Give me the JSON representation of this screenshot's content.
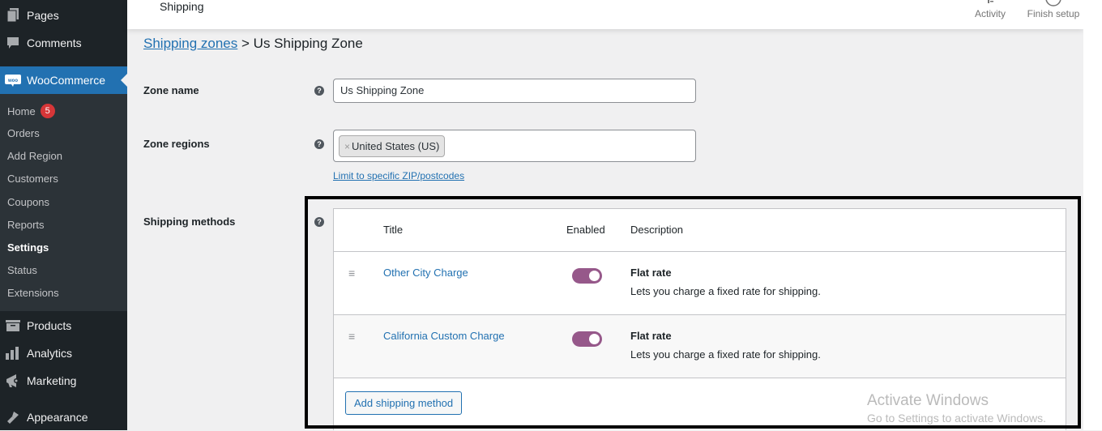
{
  "sidebar": {
    "top_items": [
      {
        "label": "Pages",
        "icon": "pages-icon"
      },
      {
        "label": "Comments",
        "icon": "comments-icon"
      }
    ],
    "active_menu": {
      "label": "WooCommerce",
      "icon": "woocommerce-icon"
    },
    "submenu": [
      {
        "label": "Home",
        "badge": "5"
      },
      {
        "label": "Orders"
      },
      {
        "label": "Add Region"
      },
      {
        "label": "Customers"
      },
      {
        "label": "Coupons"
      },
      {
        "label": "Reports"
      },
      {
        "label": "Settings",
        "active": true
      },
      {
        "label": "Status"
      },
      {
        "label": "Extensions"
      }
    ],
    "bottom_items": [
      {
        "label": "Products",
        "icon": "products-icon"
      },
      {
        "label": "Analytics",
        "icon": "analytics-icon"
      },
      {
        "label": "Marketing",
        "icon": "marketing-icon"
      },
      {
        "label": "Appearance",
        "icon": "appearance-icon"
      }
    ]
  },
  "topbar": {
    "title": "Shipping",
    "actions": [
      {
        "label": "Activity",
        "icon": "activity-icon"
      },
      {
        "label": "Finish setup",
        "icon": "progress-circle-icon"
      }
    ]
  },
  "breadcrumb": {
    "link": "Shipping zones",
    "separator": ">",
    "current": "Us Shipping Zone"
  },
  "form": {
    "zone_name_label": "Zone name",
    "zone_name_value": "Us Shipping Zone",
    "zone_regions_label": "Zone regions",
    "zone_regions": [
      {
        "label": "United States (US)",
        "remove": "×"
      }
    ],
    "limit_link": "Limit to specific ZIP/postcodes",
    "shipping_methods_label": "Shipping methods",
    "help_glyph": "?"
  },
  "methods_table": {
    "headers": {
      "title": "Title",
      "enabled": "Enabled",
      "description": "Description"
    },
    "rows": [
      {
        "title": "Other City Charge",
        "enabled": true,
        "method": "Flat rate",
        "description": "Lets you charge a fixed rate for shipping."
      },
      {
        "title": "California Custom Charge",
        "enabled": true,
        "method": "Flat rate",
        "description": "Lets you charge a fixed rate for shipping."
      }
    ],
    "drag_glyph": "≡",
    "add_button": "Add shipping method"
  },
  "watermark": {
    "line1": "Activate Windows",
    "line2": "Go to Settings to activate Windows."
  },
  "colors": {
    "sidebar_bg": "#1d2327",
    "submenu_bg": "#2c3338",
    "accent_blue": "#2271b1",
    "toggle_purple": "#96588a",
    "badge_red": "#d63638"
  }
}
